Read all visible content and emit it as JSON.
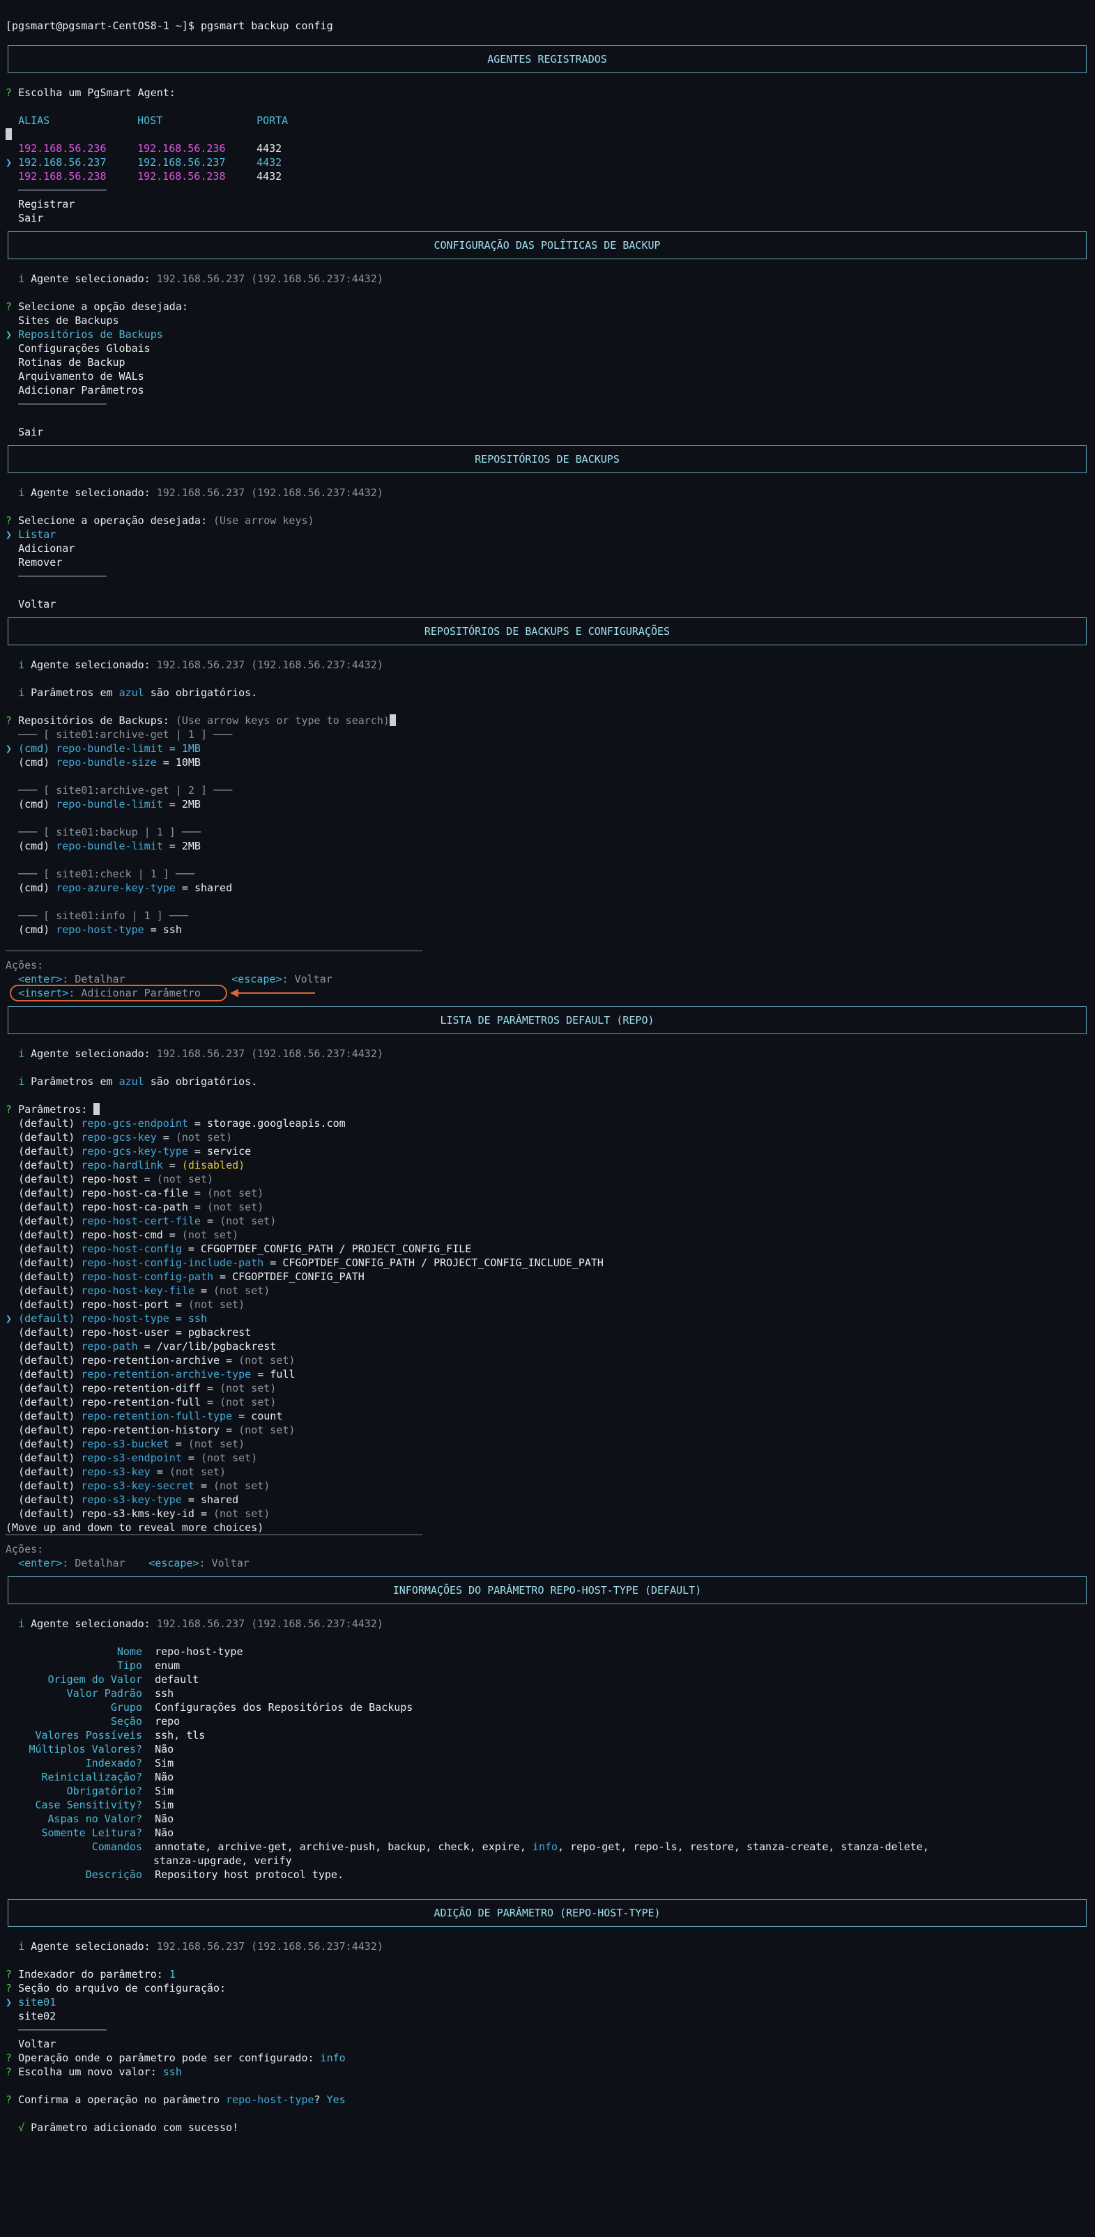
{
  "prompt": {
    "user_host": "[pgsmart@pgsmart-CentOS8-1 ~]$ ",
    "command": "pgsmart backup config"
  },
  "section1": {
    "banner": "AGENTES REGISTRADOS",
    "question": "Escolha um PgSmart Agent:",
    "headers": {
      "alias": "ALIAS",
      "host": "HOST",
      "porta": "PORTA"
    },
    "rows": [
      {
        "alias": "192.168.56.236",
        "host": "192.168.56.236",
        "porta": "4432"
      },
      {
        "alias": "192.168.56.237",
        "host": "192.168.56.237",
        "porta": "4432"
      },
      {
        "alias": "192.168.56.238",
        "host": "192.168.56.238",
        "porta": "4432"
      }
    ],
    "separator": "──────────────",
    "register": "Registrar",
    "exit": "Sair"
  },
  "section2": {
    "banner": "CONFIGURAÇÃO DAS POLÍTICAS DE BACKUP",
    "agent_label": "Agente selecionado:",
    "agent_value": "192.168.56.237 (192.168.56.237:4432)",
    "question": "Selecione a opção desejada:",
    "options": [
      "Sites de Backups",
      "Repositórios de Backups",
      "Configurações Globais",
      "Rotinas de Backup",
      "Arquivamento de WALs",
      "Adicionar Parâmetros"
    ],
    "separator": "──────────────",
    "exit": "Sair"
  },
  "section3": {
    "banner": "REPOSITÓRIOS DE BACKUPS",
    "agent_label": "Agente selecionado:",
    "agent_value": "192.168.56.237 (192.168.56.237:4432)",
    "question": "Selecione a operação desejada:",
    "hint": "(Use arrow keys)",
    "options": [
      "Listar",
      "Adicionar",
      "Remover"
    ],
    "separator": "──────────────",
    "back": "Voltar"
  },
  "section4": {
    "banner": "REPOSITÓRIOS DE BACKUPS E CONFIGURAÇÕES",
    "agent_label": "Agente selecionado:",
    "agent_value": "192.168.56.237 (192.168.56.237:4432)",
    "params_note_pre": "Parâmetros em ",
    "params_note_blue": "azul",
    "params_note_post": " são obrigatórios.",
    "question": "Repositórios de Backups:",
    "hint": "(Use arrow keys or type to search)",
    "groups": [
      {
        "header": "─── [ site01:archive-get | 1 ] ───",
        "items": [
          {
            "tag": "(cmd) ",
            "name": "repo-bundle-limit",
            "eq": " = ",
            "value": "1MB"
          },
          {
            "tag": "(cmd) ",
            "name": "repo-bundle-size",
            "eq": " = ",
            "value": "10MB"
          }
        ]
      },
      {
        "header": "─── [ site01:archive-get | 2 ] ───",
        "items": [
          {
            "tag": "(cmd) ",
            "name": "repo-bundle-limit",
            "eq": " = ",
            "value": "2MB"
          }
        ]
      },
      {
        "header": "─── [ site01:backup | 1 ] ───",
        "items": [
          {
            "tag": "(cmd) ",
            "name": "repo-bundle-limit",
            "eq": " = ",
            "value": "2MB"
          }
        ]
      },
      {
        "header": "─── [ site01:check | 1 ] ───",
        "items": [
          {
            "tag": "(cmd) ",
            "name": "repo-azure-key-type",
            "eq": " = ",
            "value": "shared"
          }
        ]
      },
      {
        "header": "─── [ site01:info | 1 ] ───",
        "items": [
          {
            "tag": "(cmd) ",
            "name": "repo-host-type",
            "eq": " = ",
            "value": "ssh"
          }
        ]
      }
    ],
    "actions_label": "Ações:",
    "action_enter_key": "<enter>",
    "action_enter_text": ": Detalhar",
    "action_escape_key": "<escape>",
    "action_escape_text": ": Voltar",
    "action_insert_key": "<insert>",
    "action_insert_text": ": Adicionar Parâmetro"
  },
  "section5": {
    "banner": "LISTA DE PARÂMETROS DEFAULT (REPO)",
    "agent_label": "Agente selecionado:",
    "agent_value": "192.168.56.237 (192.168.56.237:4432)",
    "params_note_pre": "Parâmetros em ",
    "params_note_blue": "azul",
    "params_note_post": " são obrigatórios.",
    "question": "Parâmetros:",
    "params": [
      {
        "name": "repo-gcs-endpoint",
        "req": true,
        "value": "storage.googleapis.com",
        "vstyle": "w"
      },
      {
        "name": "repo-gcs-key",
        "req": true,
        "value": "(not set)",
        "vstyle": "g"
      },
      {
        "name": "repo-gcs-key-type",
        "req": true,
        "value": "service",
        "vstyle": "w"
      },
      {
        "name": "repo-hardlink",
        "req": true,
        "value": "(disabled)",
        "vstyle": "y"
      },
      {
        "name": "repo-host",
        "req": false,
        "value": "(not set)",
        "vstyle": "g"
      },
      {
        "name": "repo-host-ca-file",
        "req": false,
        "value": "(not set)",
        "vstyle": "g"
      },
      {
        "name": "repo-host-ca-path",
        "req": false,
        "value": "(not set)",
        "vstyle": "g"
      },
      {
        "name": "repo-host-cert-file",
        "req": true,
        "value": "(not set)",
        "vstyle": "g"
      },
      {
        "name": "repo-host-cmd",
        "req": false,
        "value": "(not set)",
        "vstyle": "g"
      },
      {
        "name": "repo-host-config",
        "req": true,
        "value": "CFGOPTDEF_CONFIG_PATH / PROJECT_CONFIG_FILE",
        "vstyle": "w"
      },
      {
        "name": "repo-host-config-include-path",
        "req": true,
        "value": "CFGOPTDEF_CONFIG_PATH / PROJECT_CONFIG_INCLUDE_PATH",
        "vstyle": "w"
      },
      {
        "name": "repo-host-config-path",
        "req": true,
        "value": "CFGOPTDEF_CONFIG_PATH",
        "vstyle": "w"
      },
      {
        "name": "repo-host-key-file",
        "req": true,
        "value": "(not set)",
        "vstyle": "g"
      },
      {
        "name": "repo-host-port",
        "req": false,
        "value": "(not set)",
        "vstyle": "g"
      },
      {
        "name": "repo-host-type",
        "req": true,
        "value": "ssh",
        "vstyle": "c",
        "selected": true
      },
      {
        "name": "repo-host-user",
        "req": false,
        "value": "pgbackrest",
        "vstyle": "w"
      },
      {
        "name": "repo-path",
        "req": true,
        "value": "/var/lib/pgbackrest",
        "vstyle": "w"
      },
      {
        "name": "repo-retention-archive",
        "req": false,
        "value": "(not set)",
        "vstyle": "g"
      },
      {
        "name": "repo-retention-archive-type",
        "req": true,
        "value": "full",
        "vstyle": "w"
      },
      {
        "name": "repo-retention-diff",
        "req": false,
        "value": "(not set)",
        "vstyle": "g"
      },
      {
        "name": "repo-retention-full",
        "req": false,
        "value": "(not set)",
        "vstyle": "g"
      },
      {
        "name": "repo-retention-full-type",
        "req": true,
        "value": "count",
        "vstyle": "w"
      },
      {
        "name": "repo-retention-history",
        "req": false,
        "value": "(not set)",
        "vstyle": "g"
      },
      {
        "name": "repo-s3-bucket",
        "req": true,
        "value": "(not set)",
        "vstyle": "g"
      },
      {
        "name": "repo-s3-endpoint",
        "req": true,
        "value": "(not set)",
        "vstyle": "g"
      },
      {
        "name": "repo-s3-key",
        "req": true,
        "value": "(not set)",
        "vstyle": "g"
      },
      {
        "name": "repo-s3-key-secret",
        "req": true,
        "value": "(not set)",
        "vstyle": "g"
      },
      {
        "name": "repo-s3-key-type",
        "req": true,
        "value": "shared",
        "vstyle": "w"
      },
      {
        "name": "repo-s3-kms-key-id",
        "req": false,
        "value": "(not set)",
        "vstyle": "g"
      }
    ],
    "default_tag": "(default) ",
    "move_hint": "(Move up and down to reveal more choices)",
    "actions_label": "Ações:",
    "action_enter_key": "<enter>",
    "action_enter_text": ": Detalhar",
    "action_escape_key": "<escape>",
    "action_escape_text": ": Voltar"
  },
  "section6": {
    "banner": "INFORMAÇÕES DO PARÂMETRO REPO-HOST-TYPE (DEFAULT)",
    "agent_label": "Agente selecionado:",
    "agent_value": "192.168.56.237 (192.168.56.237:4432)",
    "info": [
      {
        "label": "Nome",
        "value": "repo-host-type"
      },
      {
        "label": "Tipo",
        "value": "enum"
      },
      {
        "label": "Origem do Valor",
        "value": "default"
      },
      {
        "label": "Valor Padrão",
        "value": "ssh"
      },
      {
        "label": "Grupo",
        "value": "Configurações dos Repositórios de Backups"
      },
      {
        "label": "Seção",
        "value": "repo"
      },
      {
        "label": "Valores Possíveis",
        "value": "ssh, tls"
      },
      {
        "label": "Múltiplos Valores?",
        "value": "Não"
      },
      {
        "label": "Indexado?",
        "value": "Sim"
      },
      {
        "label": "Reinicialização?",
        "value": "Não"
      },
      {
        "label": "Obrigatório?",
        "value": "Sim"
      },
      {
        "label": "Case Sensitivity?",
        "value": "Sim"
      },
      {
        "label": "Aspas no Valor?",
        "value": "Não"
      },
      {
        "label": "Somente Leitura?",
        "value": "Não"
      }
    ],
    "commands_label": "Comandos",
    "commands_pre": "annotate, archive-get, archive-push, backup, check, expire, ",
    "commands_info": "info",
    "commands_post": ", repo-get, repo-ls, restore, stanza-create, stanza-delete,",
    "commands_line2": "stanza-upgrade, verify",
    "description_label": "Descrição",
    "description_value": "Repository host protocol type."
  },
  "section7": {
    "banner": "ADIÇÃO DE PARÂMETRO (REPO-HOST-TYPE)",
    "agent_label": "Agente selecionado:",
    "agent_value": "192.168.56.237 (192.168.56.237:4432)",
    "indexer_q": "Indexador do parâmetro:",
    "indexer_a": "1",
    "section_q": "Seção do arquivo de configuração:",
    "sites": [
      "site01",
      "site02"
    ],
    "separator": "──────────────",
    "back": "Voltar",
    "op_q": "Operação onde o parâmetro pode ser configurado:",
    "op_a": "info",
    "value_q": "Escolha um novo valor:",
    "value_a": "ssh",
    "confirm_q": "Confirma a operação no parâmetro ",
    "confirm_param": "repo-host-type",
    "confirm_a": "Yes",
    "success_mark": "√",
    "success_text": "Parâmetro adicionado com sucesso!"
  },
  "symbols": {
    "question": "?",
    "pointer": "❯",
    "info": "i"
  }
}
